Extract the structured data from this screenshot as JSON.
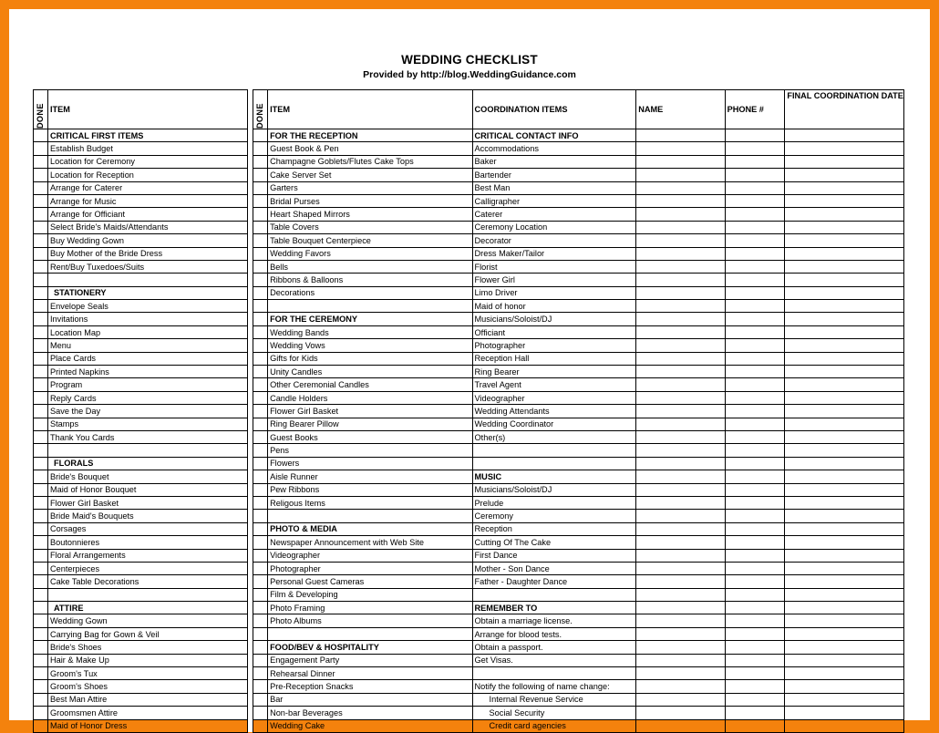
{
  "document": {
    "title": "WEDDING CHECKLIST",
    "subtitle": "Provided by http://blog.WeddingGuidance.com",
    "border_color": "#f4820d",
    "page_background": "#ffffff"
  },
  "headers": {
    "done_left": "DONE",
    "item_left": "ITEM",
    "done_middle": "DONE",
    "item_middle": "ITEM",
    "coordination_items": "COORDINATION ITEMS",
    "name": "NAME",
    "phone": "PHONE #",
    "final_coordination_date": "FINAL COORDINATION DATE"
  },
  "column_left": [
    {
      "type": "section",
      "label": "CRITICAL FIRST ITEMS"
    },
    {
      "type": "item",
      "label": "Establish Budget",
      "bold": true
    },
    {
      "type": "item",
      "label": "Location for Ceremony",
      "bold": true
    },
    {
      "type": "item",
      "label": "Location for Reception",
      "bold": true
    },
    {
      "type": "item",
      "label": "Arrange for Caterer",
      "bold": true
    },
    {
      "type": "item",
      "label": "Arrange for Music",
      "bold": true
    },
    {
      "type": "item",
      "label": "Arrange for Officiant",
      "bold": true
    },
    {
      "type": "item",
      "label": "Select Bride's Maids/Attendants",
      "bold": true
    },
    {
      "type": "item",
      "label": "Buy Wedding Gown",
      "bold": true
    },
    {
      "type": "item",
      "label": "Buy Mother of the Bride Dress",
      "bold": true
    },
    {
      "type": "item",
      "label": "Rent/Buy Tuxedoes/Suits",
      "bold": true
    },
    {
      "type": "blank",
      "label": ""
    },
    {
      "type": "section-indent",
      "label": "STATIONERY"
    },
    {
      "type": "item",
      "label": "Envelope Seals"
    },
    {
      "type": "item",
      "label": "Invitations"
    },
    {
      "type": "item",
      "label": "Location Map"
    },
    {
      "type": "item",
      "label": "Menu"
    },
    {
      "type": "item",
      "label": "Place Cards"
    },
    {
      "type": "item",
      "label": "Printed Napkins"
    },
    {
      "type": "item",
      "label": "Program"
    },
    {
      "type": "item",
      "label": "Reply Cards"
    },
    {
      "type": "item",
      "label": "Save the Day"
    },
    {
      "type": "item",
      "label": "Stamps"
    },
    {
      "type": "item",
      "label": "Thank You Cards"
    },
    {
      "type": "blank",
      "label": ""
    },
    {
      "type": "section-indent",
      "label": "FLORALS"
    },
    {
      "type": "item",
      "label": "Bride's Bouquet"
    },
    {
      "type": "item",
      "label": "Maid of Honor Bouquet"
    },
    {
      "type": "item",
      "label": "Flower Girl Basket"
    },
    {
      "type": "item",
      "label": "Bride Maid's Bouquets"
    },
    {
      "type": "item",
      "label": "Corsages"
    },
    {
      "type": "item",
      "label": "Boutonnieres"
    },
    {
      "type": "item",
      "label": "Floral Arrangements"
    },
    {
      "type": "item",
      "label": "Centerpieces"
    },
    {
      "type": "item",
      "label": "Cake Table Decorations"
    },
    {
      "type": "blank",
      "label": ""
    },
    {
      "type": "section-indent",
      "label": "ATTIRE"
    },
    {
      "type": "item",
      "label": "Wedding Gown"
    },
    {
      "type": "item",
      "label": "Carrying Bag for Gown & Veil"
    },
    {
      "type": "item",
      "label": "Bride's Shoes"
    },
    {
      "type": "item",
      "label": "Hair & Make Up"
    },
    {
      "type": "item",
      "label": "Groom's Tux"
    },
    {
      "type": "item",
      "label": "Groom's Shoes"
    },
    {
      "type": "item",
      "label": "Best Man Attire"
    },
    {
      "type": "item",
      "label": "Groomsmen Attire"
    },
    {
      "type": "item",
      "label": "Maid of Honor Dress"
    }
  ],
  "column_middle": [
    {
      "type": "section",
      "label": "FOR THE RECEPTION"
    },
    {
      "type": "item",
      "label": "Guest Book & Pen"
    },
    {
      "type": "item",
      "label": "Champagne Goblets/Flutes Cake Tops"
    },
    {
      "type": "item",
      "label": "Cake Server Set"
    },
    {
      "type": "item",
      "label": "Garters"
    },
    {
      "type": "item",
      "label": "Bridal Purses"
    },
    {
      "type": "item",
      "label": "Heart Shaped Mirrors"
    },
    {
      "type": "item",
      "label": "Table Covers"
    },
    {
      "type": "item",
      "label": "Table Bouquet Centerpiece"
    },
    {
      "type": "item",
      "label": "Wedding Favors"
    },
    {
      "type": "item",
      "label": "Bells"
    },
    {
      "type": "item",
      "label": "Ribbons & Balloons"
    },
    {
      "type": "item",
      "label": "Decorations"
    },
    {
      "type": "blank",
      "label": ""
    },
    {
      "type": "section",
      "label": "FOR THE CEREMONY"
    },
    {
      "type": "item",
      "label": "Wedding Bands"
    },
    {
      "type": "item",
      "label": "Wedding Vows"
    },
    {
      "type": "item",
      "label": "Gifts for Kids"
    },
    {
      "type": "item",
      "label": "Unity Candles"
    },
    {
      "type": "item",
      "label": "Other Ceremonial Candles"
    },
    {
      "type": "item",
      "label": "Candle Holders"
    },
    {
      "type": "item",
      "label": "Flower Girl Basket"
    },
    {
      "type": "item",
      "label": "Ring Bearer Pillow"
    },
    {
      "type": "item",
      "label": "Guest Books"
    },
    {
      "type": "item",
      "label": "Pens"
    },
    {
      "type": "item",
      "label": "Flowers"
    },
    {
      "type": "item",
      "label": "Aisle Runner"
    },
    {
      "type": "item",
      "label": "Pew Ribbons"
    },
    {
      "type": "item",
      "label": "Religous Items"
    },
    {
      "type": "blank",
      "label": ""
    },
    {
      "type": "section",
      "label": "PHOTO & MEDIA"
    },
    {
      "type": "item",
      "label": "Newspaper Announcement with Web Site"
    },
    {
      "type": "item",
      "label": "Videographer"
    },
    {
      "type": "item",
      "label": "Photographer"
    },
    {
      "type": "item",
      "label": "Personal Guest Cameras"
    },
    {
      "type": "item",
      "label": "Film & Developing"
    },
    {
      "type": "item",
      "label": "Photo Framing"
    },
    {
      "type": "item",
      "label": "Photo Albums"
    },
    {
      "type": "blank",
      "label": ""
    },
    {
      "type": "section",
      "label": "FOOD/BEV & HOSPITALITY"
    },
    {
      "type": "item",
      "label": "Engagement Party"
    },
    {
      "type": "item",
      "label": "Rehearsal Dinner"
    },
    {
      "type": "item",
      "label": "Pre-Reception Snacks"
    },
    {
      "type": "item",
      "label": "Bar"
    },
    {
      "type": "item",
      "label": "Non-bar Beverages"
    },
    {
      "type": "item",
      "label": "Wedding Cake"
    }
  ],
  "column_right": [
    {
      "type": "section",
      "label": "CRITICAL CONTACT INFO"
    },
    {
      "type": "item",
      "label": "Accommodations"
    },
    {
      "type": "item",
      "label": "Baker"
    },
    {
      "type": "item",
      "label": "Bartender"
    },
    {
      "type": "item",
      "label": "Best Man"
    },
    {
      "type": "item",
      "label": "Calligrapher"
    },
    {
      "type": "item",
      "label": "Caterer"
    },
    {
      "type": "item",
      "label": "Ceremony Location"
    },
    {
      "type": "item",
      "label": "Decorator"
    },
    {
      "type": "item",
      "label": "Dress Maker/Tailor"
    },
    {
      "type": "item",
      "label": "Florist"
    },
    {
      "type": "item",
      "label": "Flower Girl"
    },
    {
      "type": "item",
      "label": "Limo Driver"
    },
    {
      "type": "item",
      "label": "Maid of honor"
    },
    {
      "type": "item",
      "label": "Musicians/Soloist/DJ"
    },
    {
      "type": "item",
      "label": "Officiant"
    },
    {
      "type": "item",
      "label": "Photographer"
    },
    {
      "type": "item",
      "label": "Reception Hall"
    },
    {
      "type": "item",
      "label": "Ring Bearer"
    },
    {
      "type": "item",
      "label": "Travel Agent"
    },
    {
      "type": "item",
      "label": "Videographer"
    },
    {
      "type": "item",
      "label": "Wedding Attendants"
    },
    {
      "type": "item",
      "label": "Wedding Coordinator"
    },
    {
      "type": "item",
      "label": "Other(s)"
    },
    {
      "type": "blank",
      "label": ""
    },
    {
      "type": "blank",
      "label": ""
    },
    {
      "type": "section",
      "label": "MUSIC"
    },
    {
      "type": "item",
      "label": "Musicians/Soloist/DJ"
    },
    {
      "type": "item",
      "label": "Prelude"
    },
    {
      "type": "item",
      "label": "Ceremony"
    },
    {
      "type": "item",
      "label": "Reception"
    },
    {
      "type": "item",
      "label": "Cutting Of The Cake"
    },
    {
      "type": "item",
      "label": "First Dance"
    },
    {
      "type": "item",
      "label": "Mother - Son Dance"
    },
    {
      "type": "item",
      "label": "Father - Daughter Dance"
    },
    {
      "type": "blank",
      "label": ""
    },
    {
      "type": "section",
      "label": "REMEMBER TO"
    },
    {
      "type": "item",
      "label": "Obtain a marriage license."
    },
    {
      "type": "item",
      "label": "Arrange for blood tests."
    },
    {
      "type": "item",
      "label": "Obtain a passport."
    },
    {
      "type": "item",
      "label": "Get Visas."
    },
    {
      "type": "blank",
      "label": ""
    },
    {
      "type": "item",
      "label": "Notify the following of name change:"
    },
    {
      "type": "item-indent",
      "label": "Internal Revenue Service"
    },
    {
      "type": "item-indent",
      "label": "Social Security"
    },
    {
      "type": "item-indent",
      "label": "Credit card agencies"
    }
  ]
}
